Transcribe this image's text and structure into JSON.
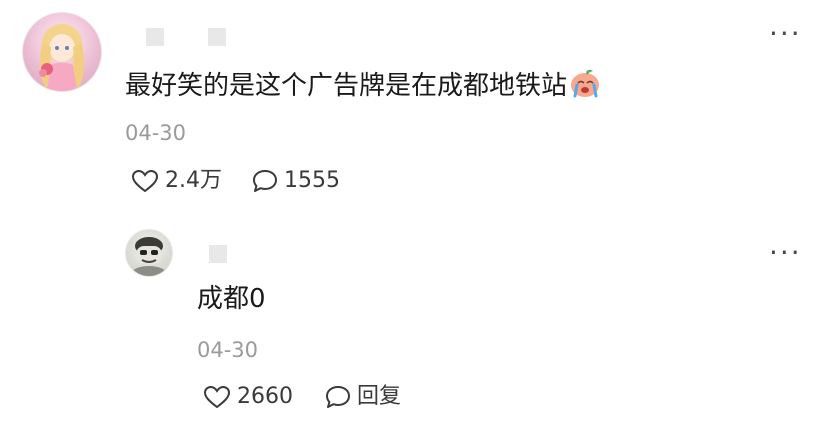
{
  "comment": {
    "text": "最好笑的是这个广告牌是在成都地铁站",
    "emoji_icon": "crying-face-emoji",
    "date": "04-30",
    "likes": "2.4万",
    "replies": "1555",
    "more_icon": "more-dots-icon"
  },
  "reply": {
    "text": "成都0",
    "date": "04-30",
    "likes": "2660",
    "reply_label": "回复",
    "more_icon": "more-dots-icon"
  }
}
